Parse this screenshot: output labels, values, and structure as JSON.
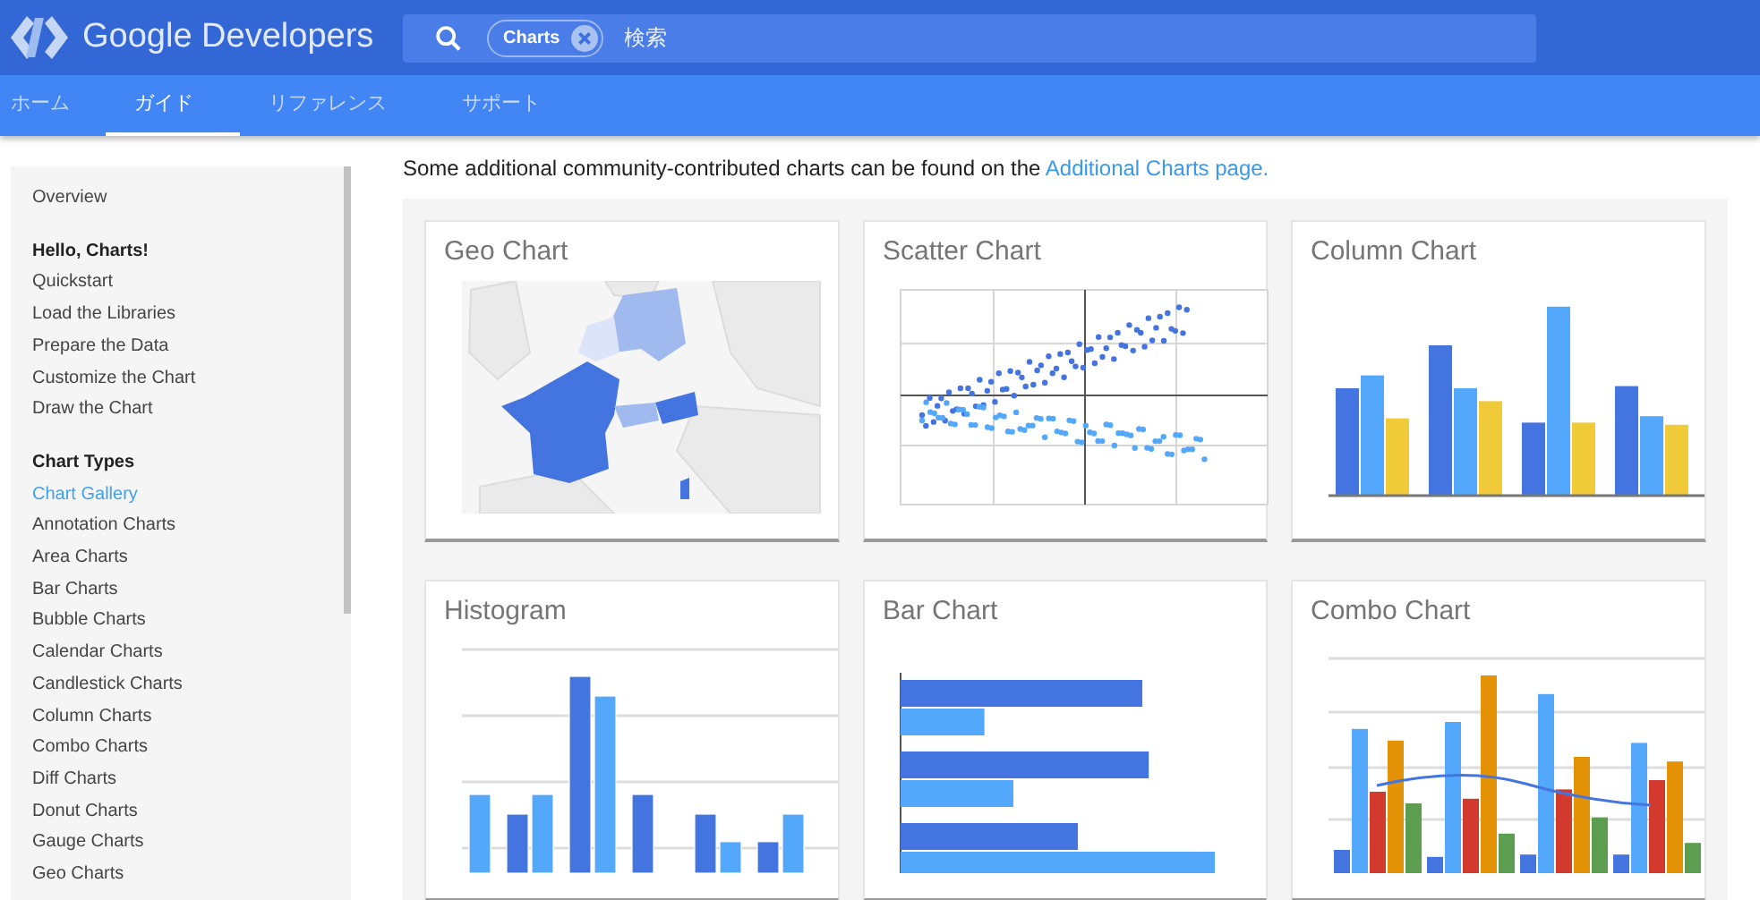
{
  "header": {
    "logo_text": "Google Developers",
    "search": {
      "chip": "Charts",
      "placeholder": "検索"
    }
  },
  "tabs": [
    {
      "label": "ホーム",
      "selected": false
    },
    {
      "label": "ガイド",
      "selected": true
    },
    {
      "label": "リファレンス",
      "selected": false
    },
    {
      "label": "サポート",
      "selected": false
    }
  ],
  "sidebar": {
    "items": [
      {
        "kind": "link",
        "label": "Overview",
        "selected": false
      },
      {
        "kind": "heading",
        "label": "Hello, Charts!"
      },
      {
        "kind": "link",
        "label": "Quickstart",
        "selected": false
      },
      {
        "kind": "link",
        "label": "Load the Libraries",
        "selected": false
      },
      {
        "kind": "link",
        "label": "Prepare the Data",
        "selected": false
      },
      {
        "kind": "link",
        "label": "Customize the Chart",
        "selected": false
      },
      {
        "kind": "link",
        "label": "Draw the Chart",
        "selected": false
      },
      {
        "kind": "heading",
        "label": "Chart Types"
      },
      {
        "kind": "link",
        "label": "Chart Gallery",
        "selected": true
      },
      {
        "kind": "link",
        "label": "Annotation Charts",
        "selected": false
      },
      {
        "kind": "link",
        "label": "Area Charts",
        "selected": false
      },
      {
        "kind": "link",
        "label": "Bar Charts",
        "selected": false
      },
      {
        "kind": "link",
        "label": "Bubble Charts",
        "selected": false
      },
      {
        "kind": "link",
        "label": "Calendar Charts",
        "selected": false
      },
      {
        "kind": "link",
        "label": "Candlestick Charts",
        "selected": false
      },
      {
        "kind": "link",
        "label": "Column Charts",
        "selected": false
      },
      {
        "kind": "link",
        "label": "Combo Charts",
        "selected": false
      },
      {
        "kind": "link",
        "label": "Diff Charts",
        "selected": false
      },
      {
        "kind": "link",
        "label": "Donut Charts",
        "selected": false
      },
      {
        "kind": "link",
        "label": "Gauge Charts",
        "selected": false
      },
      {
        "kind": "link",
        "label": "Geo Charts",
        "selected": false
      }
    ]
  },
  "intro": {
    "text": "Some additional community-contributed charts can be found on the",
    "link": "Additional Charts page."
  },
  "gallery": [
    {
      "title": "Geo Chart",
      "kind": "geo"
    },
    {
      "title": "Scatter Chart",
      "kind": "scatter"
    },
    {
      "title": "Column Chart",
      "kind": "column"
    },
    {
      "title": "Histogram",
      "kind": "histogram"
    },
    {
      "title": "Bar Chart",
      "kind": "bar"
    },
    {
      "title": "Combo Chart",
      "kind": "combo"
    }
  ]
}
